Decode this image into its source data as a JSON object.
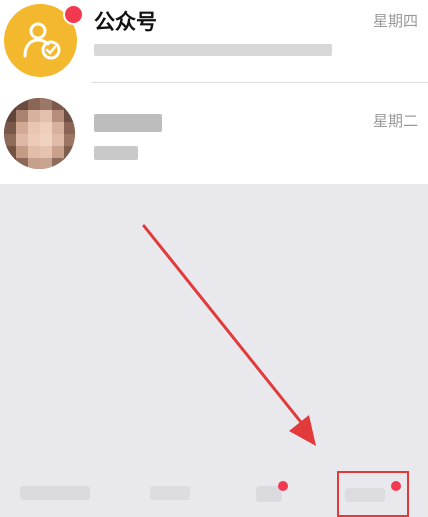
{
  "conversations": [
    {
      "title": "公众号",
      "time": "星期四",
      "avatar_icon": "official-account-icon",
      "unread_badge": true
    },
    {
      "title": "",
      "time": "星期二",
      "avatar_icon": "contact-avatar",
      "unread_badge": false
    }
  ],
  "colors": {
    "official_account_avatar": "#f4b82e",
    "badge": "#f2394f",
    "annotation": "#e23a3a",
    "background": "#e8e8ed"
  }
}
